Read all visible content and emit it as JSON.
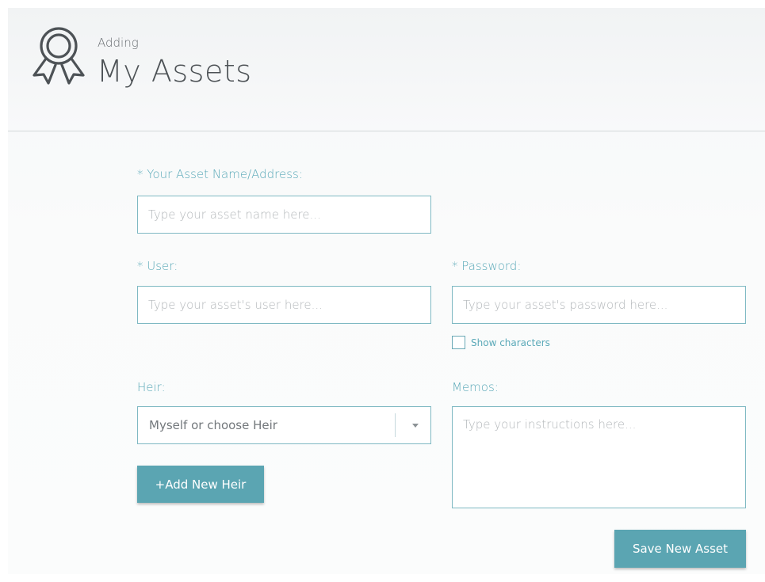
{
  "header": {
    "subtitle": "Adding",
    "title": "My Assets",
    "icon": "award-ribbon-icon"
  },
  "form": {
    "asset_name": {
      "label": "* Your Asset Name/Address:",
      "placeholder": "Type your asset name here...",
      "value": ""
    },
    "user": {
      "label": "* User:",
      "placeholder": "Type your asset's user here...",
      "value": ""
    },
    "password": {
      "label": "* Password:",
      "placeholder": "Type your asset's password here...",
      "value": ""
    },
    "show_characters": {
      "label": "Show characters",
      "checked": false
    },
    "heir": {
      "label": "Heir:",
      "selected": "Myself or choose Heir"
    },
    "memos": {
      "label": "Memos:",
      "placeholder": "Type your instructions here...",
      "value": ""
    }
  },
  "buttons": {
    "add_heir": "+Add New Heir",
    "save_asset": "Save New Asset"
  },
  "colors": {
    "accent": "#5ba5b2",
    "label": "#5aa9b8",
    "border": "#7fb9c3"
  }
}
